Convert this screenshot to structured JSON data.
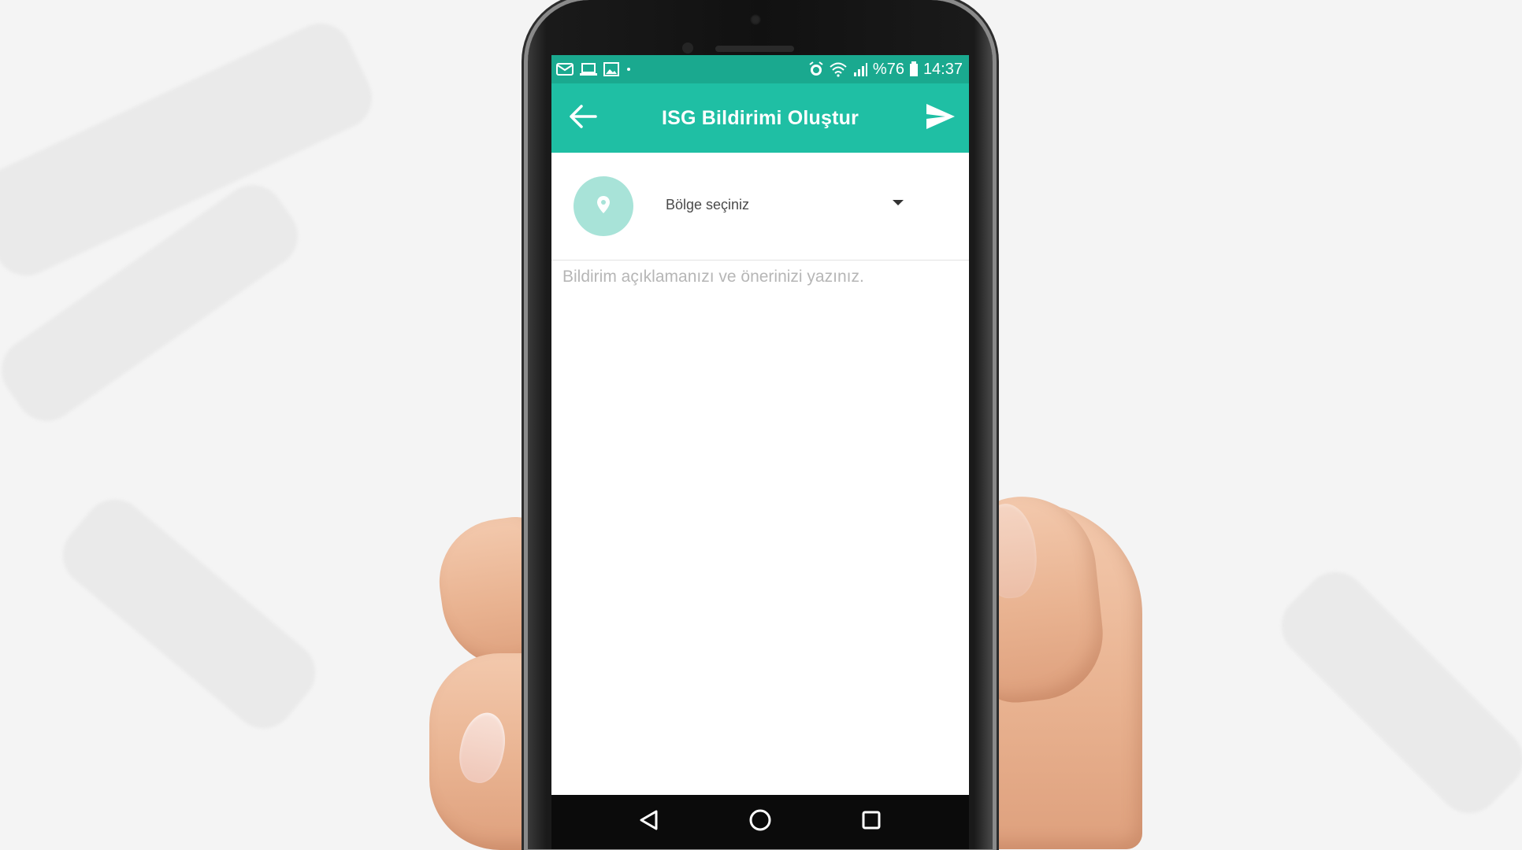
{
  "statusbar": {
    "battery_percent": "%76",
    "time": "14:37",
    "left_icons": [
      "mail-icon",
      "laptop-icon",
      "image-icon",
      "dot-icon"
    ],
    "right_icons": [
      "alarm-icon",
      "wifi-icon",
      "signal-icon",
      "battery-icon"
    ]
  },
  "appbar": {
    "title": "ISG Bildirimi Oluştur",
    "back_icon": "arrow-left-icon",
    "send_icon": "send-icon"
  },
  "region": {
    "label": "Bölge seçiniz",
    "icon": "location-pin-icon"
  },
  "description": {
    "placeholder": "Bildirim açıklamanızı ve önerinizi yazınız.",
    "value": ""
  },
  "navbar": {
    "icons": [
      "back-triangle-icon",
      "home-circle-icon",
      "recents-square-icon"
    ]
  },
  "colors": {
    "appbar": "#1fbfa4",
    "statusbar": "#1aa98f",
    "region_icon_bg": "#a8e3d8",
    "placeholder": "#b6b6b6"
  }
}
